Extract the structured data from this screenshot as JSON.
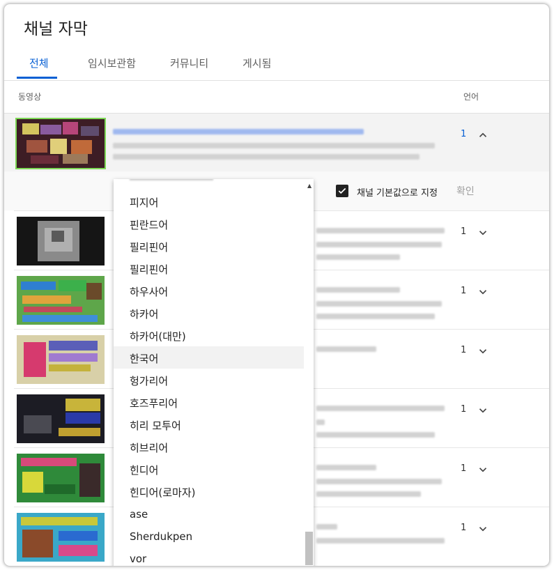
{
  "page": {
    "title": "채널 자막"
  },
  "tabs": [
    {
      "label": "전체",
      "active": true
    },
    {
      "label": "임시보관함",
      "active": false
    },
    {
      "label": "커뮤니티",
      "active": false
    },
    {
      "label": "게시됨",
      "active": false
    }
  ],
  "table": {
    "col_video": "동영상",
    "col_language": "언어"
  },
  "rows": [
    {
      "count": "1",
      "expanded": true
    },
    {
      "count": "1",
      "expanded": false
    },
    {
      "count": "1",
      "expanded": false
    },
    {
      "count": "1",
      "expanded": false
    },
    {
      "count": "1",
      "expanded": false
    },
    {
      "count": "1",
      "expanded": false
    },
    {
      "count": "1",
      "expanded": false
    }
  ],
  "editor": {
    "default_checkbox_label": "채널 기본값으로 지정",
    "default_checked": true,
    "confirm_label": "확인"
  },
  "language_dropdown": {
    "items": [
      "피지어",
      "핀란드어",
      "필리핀어",
      "필리핀어",
      "하우사어",
      "하카어",
      "하카어(대만)",
      "한국어",
      "헝가리어",
      "호즈푸리어",
      "히리 모투어",
      "히브리어",
      "힌디어",
      "힌디어(로마자)",
      "ase",
      "Sherdukpen",
      "vor"
    ],
    "highlighted": "한국어"
  },
  "colors": {
    "accent": "#065fd4",
    "selected_thumb_border": "#7ed957"
  }
}
